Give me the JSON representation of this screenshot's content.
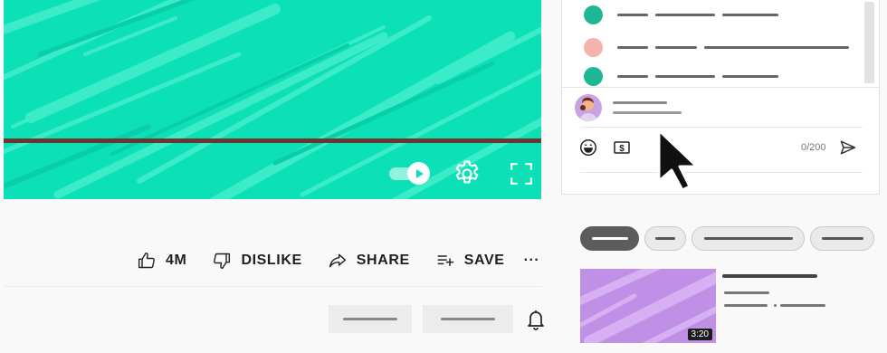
{
  "player": {
    "background_color": "#0ce0b7",
    "progress_color": "#6b3530",
    "controls": [
      "autoplay-toggle-icon",
      "settings-gear-icon",
      "fullscreen-icon"
    ]
  },
  "actions": {
    "like_count": "4M",
    "dislike_label": "DISLIKE",
    "share_label": "SHARE",
    "save_label": "SAVE",
    "more_label": "···"
  },
  "chat": {
    "messages": [
      {
        "avatar_color": "#1fb895"
      },
      {
        "avatar_color": "#f5b3ad"
      },
      {
        "avatar_color": "#1fb895"
      }
    ],
    "char_count": "0/200"
  },
  "recommendation": {
    "thumbnail_color": "#c08fe6",
    "duration": "3:20"
  }
}
